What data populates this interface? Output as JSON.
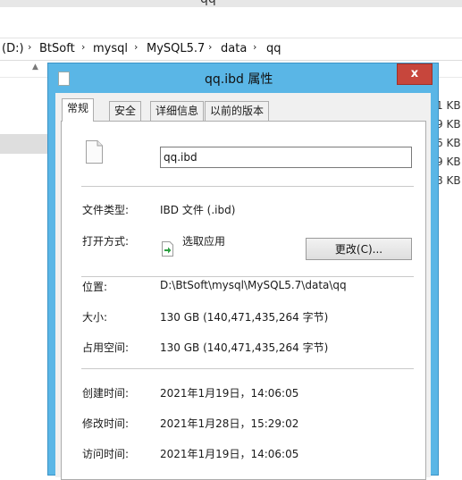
{
  "explorer": {
    "window_title": "qq",
    "breadcrumb": [
      {
        "label": "(D:)"
      },
      {
        "label": "BtSoft"
      },
      {
        "label": "mysql"
      },
      {
        "label": "MySQL5.7"
      },
      {
        "label": "data"
      },
      {
        "label": "qq"
      }
    ],
    "separator": "›",
    "sort_arrow": "▲",
    "sizes": [
      "1 KB",
      "9 KB",
      "6 KB",
      "9 KB",
      "8 KB"
    ]
  },
  "dialog": {
    "title": "qq.ibd 属性",
    "close_label": "x",
    "tabs": [
      {
        "label": "常规",
        "active": true
      },
      {
        "label": "安全",
        "active": false
      },
      {
        "label": "详细信息",
        "active": false
      },
      {
        "label": "以前的版本",
        "active": false
      }
    ],
    "file_name": "qq.ibd",
    "file_type_label": "文件类型:",
    "file_type_value": "IBD 文件 (.ibd)",
    "open_with_label": "打开方式:",
    "open_with_value": "选取应用",
    "change_button": "更改(C)...",
    "location_label": "位置:",
    "location_value": "D:\\BtSoft\\mysql\\MySQL5.7\\data\\qq",
    "size_label": "大小:",
    "size_value": "130 GB (140,471,435,264 字节)",
    "size_on_disk_label": "占用空间:",
    "size_on_disk_value": "130 GB (140,471,435,264 字节)",
    "created_label": "创建时间:",
    "created_value": "2021年1月19日，14:06:05",
    "modified_label": "修改时间:",
    "modified_value": "2021年1月28日，15:29:02",
    "accessed_label": "访问时间:",
    "accessed_value": "2021年1月19日，14:06:05"
  }
}
